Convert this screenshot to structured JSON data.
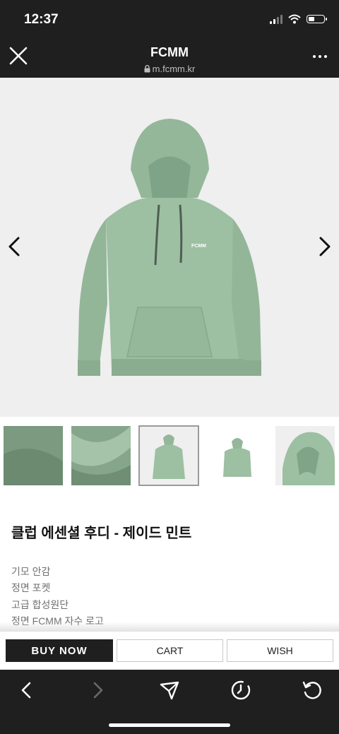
{
  "status": {
    "time": "12:37"
  },
  "header": {
    "title": "FCMM",
    "url": "m.fcmm.kr"
  },
  "product": {
    "title": "클럽 에센셜 후디 - 제이드 민트",
    "features": [
      "기모 안감",
      "정면 포켓",
      "고급 합성원단",
      "정면 FCMM 자수 로고"
    ],
    "logo_text": "FCMM",
    "color": "#9dbfa2"
  },
  "actions": {
    "buy": "BUY NOW",
    "cart": "CART",
    "wish": "WISH"
  },
  "icons": [
    "close-icon",
    "lock-icon",
    "more-icon",
    "chevron-left-icon",
    "chevron-right-icon",
    "back-icon",
    "forward-icon",
    "share-icon",
    "history-icon",
    "reload-icon"
  ]
}
